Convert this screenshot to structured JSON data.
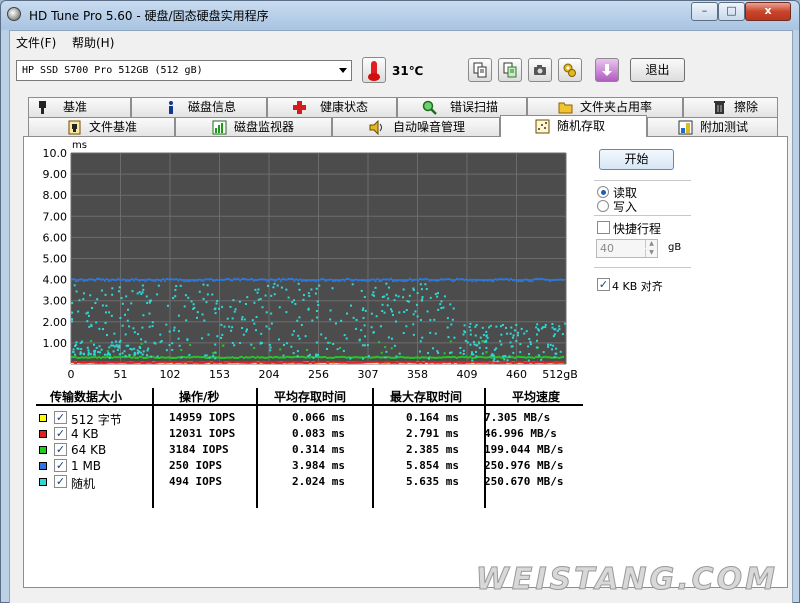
{
  "window": {
    "title": "HD Tune Pro 5.60 - 硬盘/固态硬盘实用程序",
    "min": "–",
    "max": "□",
    "close": "x"
  },
  "menu": [
    "文件(F)",
    "帮助(H)"
  ],
  "toolbar": {
    "drive": "HP SSD S700 Pro 512GB (512 gB)",
    "temperature": "31℃",
    "exit_label": "退出"
  },
  "tabs_top": [
    "基准",
    "磁盘信息",
    "健康状态",
    "错误扫描",
    "文件夹占用率",
    "擦除"
  ],
  "tabs_bottom": [
    "文件基准",
    "磁盘监视器",
    "自动噪音管理",
    "随机存取",
    "附加测试"
  ],
  "active_tab": "随机存取",
  "controls": {
    "start_label": "开始",
    "read_label": "读取",
    "write_label": "写入",
    "mode": "read",
    "quick_label": "快捷行程",
    "quick_checked": false,
    "quick_value": "40",
    "quick_unit": "gB",
    "align_label": "4 KB 对齐",
    "align_checked": true
  },
  "chart_data": {
    "type": "scatter",
    "y_unit": "ms",
    "ylim": [
      0,
      10
    ],
    "yticks": [
      "10.0",
      "9.00",
      "8.00",
      "7.00",
      "6.00",
      "5.00",
      "4.00",
      "3.00",
      "2.00",
      "1.00"
    ],
    "xlim": [
      0,
      512
    ],
    "xticks": [
      "0",
      "51",
      "102",
      "153",
      "204",
      "256",
      "307",
      "358",
      "409",
      "460",
      "512gB"
    ],
    "background": "#4c4c4c",
    "grid": true,
    "series": [
      {
        "name": "512 字节",
        "color": "#ffff00",
        "level": 0.066
      },
      {
        "name": "4 KB",
        "color": "#e02020",
        "level": 0.083
      },
      {
        "name": "64 KB",
        "color": "#22cc22",
        "level": 0.314
      },
      {
        "name": "1 MB",
        "color": "#2a78e0",
        "level": 3.984
      },
      {
        "name": "随机",
        "color": "#2fd8d8",
        "level": 2.024
      }
    ]
  },
  "table": {
    "headers": [
      "传输数据大小",
      "操作/秒",
      "平均存取时间",
      "最大存取时间",
      "平均速度"
    ],
    "rows": [
      {
        "name": "512 字节",
        "color": "#ffff00",
        "iops": "14959 IOPS",
        "avg": "0.066 ms",
        "max": "0.164 ms",
        "speed": "7.305 MB/s"
      },
      {
        "name": "4 KB",
        "color": "#e02020",
        "iops": "12031 IOPS",
        "avg": "0.083 ms",
        "max": "2.791 ms",
        "speed": "46.996 MB/s"
      },
      {
        "name": "64 KB",
        "color": "#22cc22",
        "iops": "3184 IOPS",
        "avg": "0.314 ms",
        "max": "2.385 ms",
        "speed": "199.044 MB/s"
      },
      {
        "name": "1 MB",
        "color": "#2a78e0",
        "iops": "250 IOPS",
        "avg": "3.984 ms",
        "max": "5.854 ms",
        "speed": "250.976 MB/s"
      },
      {
        "name": "随机",
        "color": "#2fd8d8",
        "iops": "494 IOPS",
        "avg": "2.024 ms",
        "max": "5.635 ms",
        "speed": "250.670 MB/s"
      }
    ]
  },
  "watermark": "WEISTANG.COM"
}
